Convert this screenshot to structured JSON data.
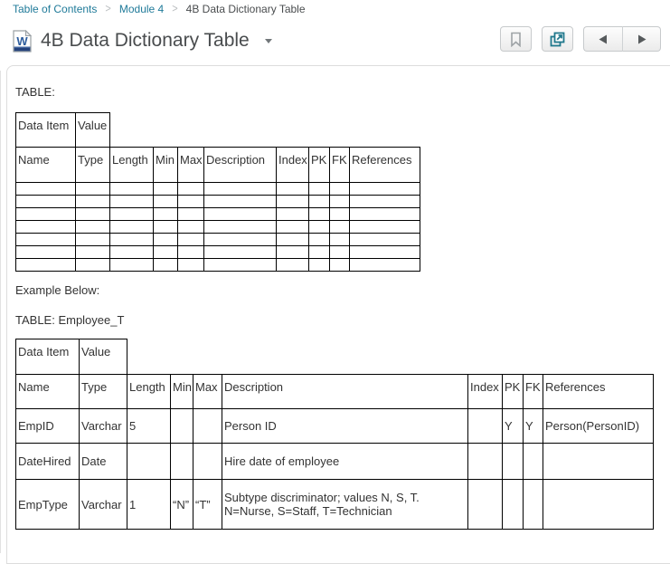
{
  "colors": {
    "link": "#1f7a99",
    "title_text": "#494c4e",
    "accent_teal": "#20788c",
    "table_border": "#000000",
    "panel_border": "#dcdcdc"
  },
  "icons": {
    "doc": "word-document-icon",
    "doc_letter": "W",
    "bookmark": "bookmark-icon",
    "open_in_new": "open-in-new-window-icon",
    "previous": "previous-arrow-icon",
    "next": "next-arrow-icon",
    "dropdown": "chevron-down-icon"
  },
  "breadcrumb": {
    "separator": ">",
    "items": [
      {
        "label": "Table of Contents",
        "current": false
      },
      {
        "label": "Module 4",
        "current": false
      },
      {
        "label": "4B Data Dictionary Table",
        "current": true
      }
    ]
  },
  "header": {
    "title": "4B Data Dictionary Table"
  },
  "content": {
    "table_label": "TABLE:",
    "example_label": "Example Below:",
    "example_table_label": "TABLE: Employee_T"
  },
  "blank_table": {
    "meta_headers": [
      "Data Item",
      "Value"
    ],
    "columns": [
      "Name",
      "Type",
      "Length",
      "Min",
      "Max",
      "Description",
      "Index",
      "PK",
      "FK",
      "References"
    ],
    "empty_row_count": 7
  },
  "example_table": {
    "meta_headers": [
      "Data Item",
      "Value"
    ],
    "columns": [
      "Name",
      "Type",
      "Length",
      "Min",
      "Max",
      "Description",
      "Index",
      "PK",
      "FK",
      "References"
    ],
    "rows": [
      [
        "EmpID",
        "Varchar",
        "5",
        "",
        "",
        "Person ID",
        "",
        "Y",
        "Y",
        "Person(PersonID)"
      ],
      [
        "DateHired",
        "Date",
        "",
        "",
        "",
        "Hire date of employee",
        "",
        "",
        "",
        ""
      ],
      [
        "EmpType",
        "Varchar",
        "1",
        "“N”",
        "“T”",
        "Subtype discriminator; values N, S, T. N=Nurse, S=Staff, T=Technician",
        "",
        "",
        "",
        ""
      ]
    ]
  }
}
